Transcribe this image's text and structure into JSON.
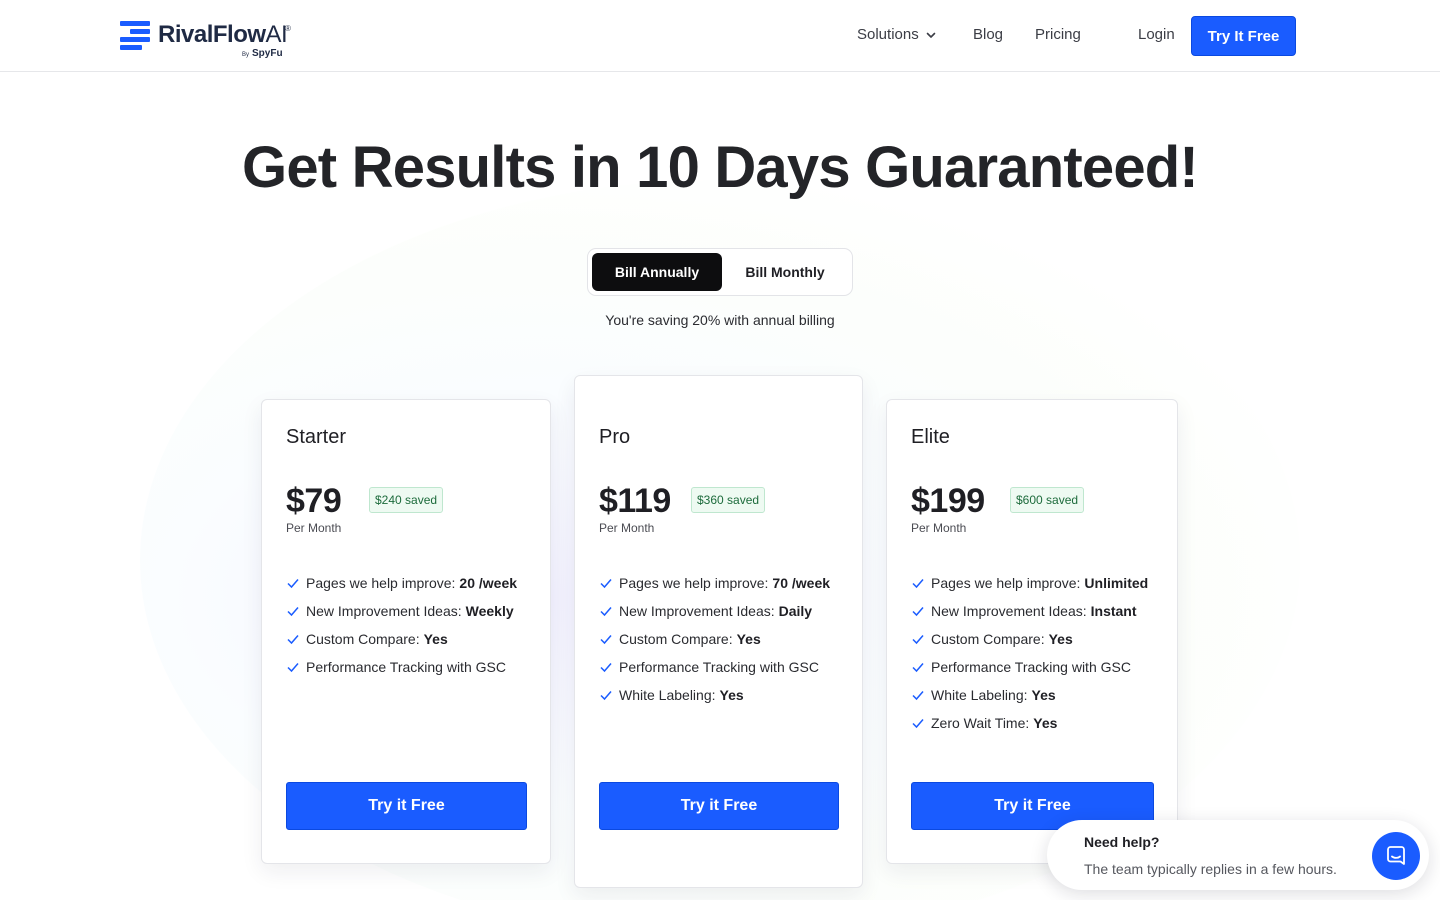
{
  "brand": {
    "name": "RivalFlow",
    "name_suffix": "AI",
    "registered_mark": "®",
    "by_label": "By",
    "by_name": "SpyFu",
    "color": "#1a5cff"
  },
  "nav": {
    "solutions": "Solutions",
    "blog": "Blog",
    "pricing": "Pricing",
    "login": "Login",
    "cta": "Try It Free"
  },
  "hero": {
    "title": "Get Results in 10 Days Guaranteed!",
    "toggle_annual": "Bill Annually",
    "toggle_monthly": "Bill Monthly",
    "selected_billing": "Bill Annually",
    "saving_note": "You're saving 20% with annual billing"
  },
  "plans": [
    {
      "name": "Starter",
      "price": "$79",
      "saved": "$240 saved",
      "period": "Per Month",
      "features": [
        {
          "label": "Pages we help improve:",
          "value": "20 /week"
        },
        {
          "label": "New Improvement Ideas:",
          "value": "Weekly"
        },
        {
          "label": "Custom Compare:",
          "value": "Yes"
        },
        {
          "label": "Performance Tracking with GSC",
          "value": ""
        }
      ],
      "cta": "Try it Free"
    },
    {
      "name": "Pro",
      "price": "$119",
      "saved": "$360 saved",
      "period": "Per Month",
      "features": [
        {
          "label": "Pages we help improve:",
          "value": "70 /week"
        },
        {
          "label": "New Improvement Ideas:",
          "value": "Daily"
        },
        {
          "label": "Custom Compare:",
          "value": "Yes"
        },
        {
          "label": "Performance Tracking with GSC",
          "value": ""
        },
        {
          "label": "White Labeling:",
          "value": "Yes"
        }
      ],
      "cta": "Try it Free"
    },
    {
      "name": "Elite",
      "price": "$199",
      "saved": "$600 saved",
      "period": "Per Month",
      "features": [
        {
          "label": "Pages we help improve:",
          "value": "Unlimited"
        },
        {
          "label": "New Improvement Ideas:",
          "value": "Instant"
        },
        {
          "label": "Custom Compare:",
          "value": "Yes"
        },
        {
          "label": "Performance Tracking with GSC",
          "value": ""
        },
        {
          "label": "White Labeling:",
          "value": "Yes"
        },
        {
          "label": "Zero Wait Time:",
          "value": "Yes"
        }
      ],
      "cta": "Try it Free"
    }
  ],
  "help_widget": {
    "title": "Need help?",
    "subtitle": "The team typically replies in a few hours.",
    "icon": "chat-icon"
  },
  "colors": {
    "accent": "#1a5cff",
    "toggle_active": "#0d0d0f",
    "saved_badge_text": "#1d6b3c",
    "saved_badge_bg": "#eefaf2",
    "check": "#1a5cff"
  }
}
